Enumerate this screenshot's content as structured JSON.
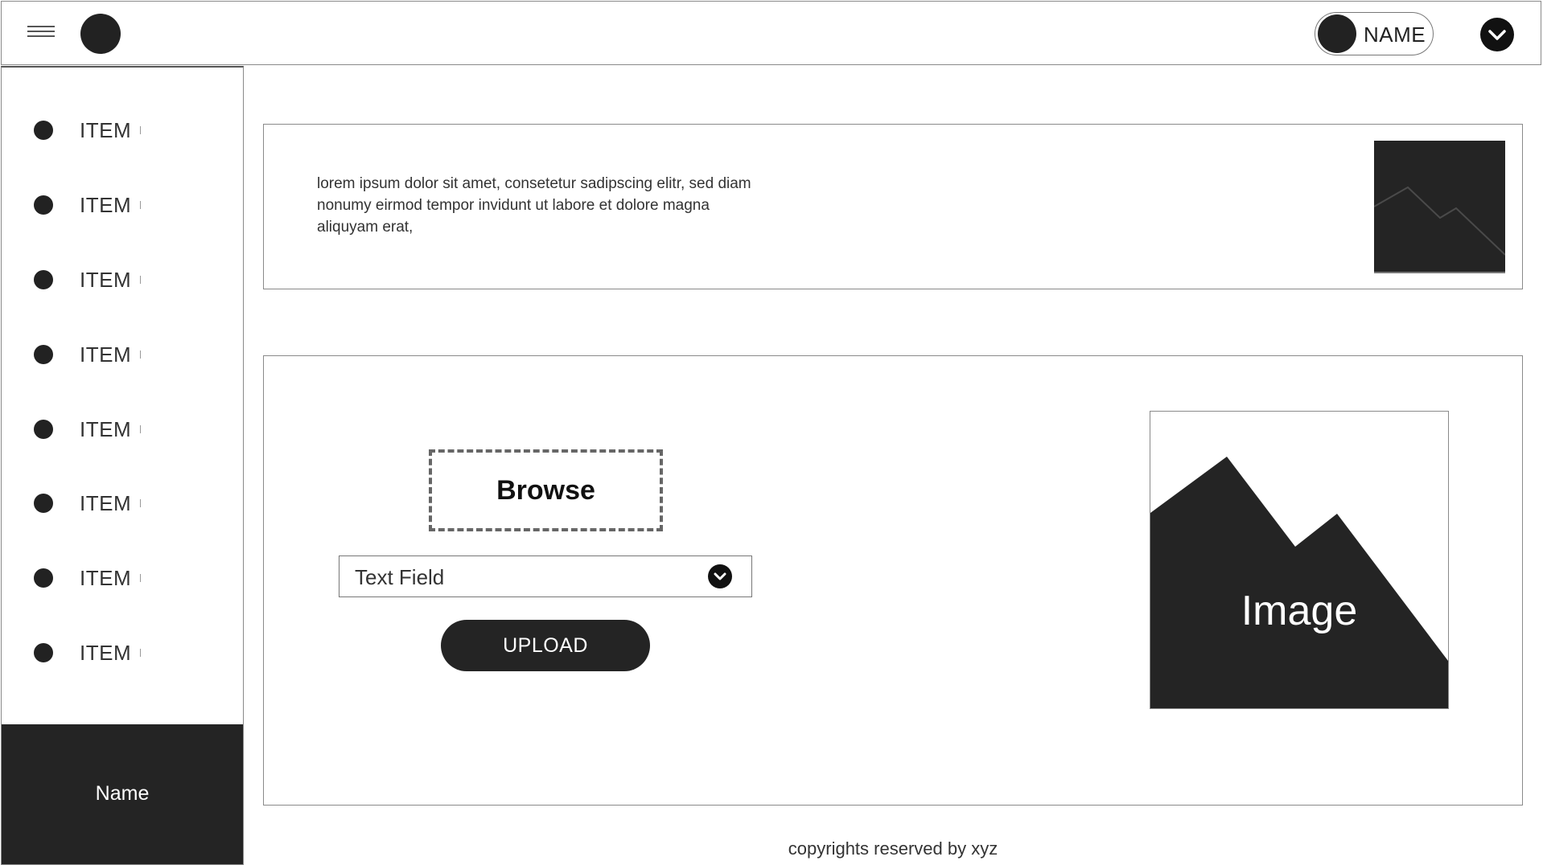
{
  "header": {
    "menu_icon": "hamburger-icon",
    "logo_icon": "circle-logo",
    "profile": {
      "name": "NAME"
    },
    "dropdown_icon": "chevron-down-icon"
  },
  "sidebar": {
    "items": [
      {
        "label": "ITEM"
      },
      {
        "label": "ITEM"
      },
      {
        "label": "ITEM"
      },
      {
        "label": "ITEM"
      },
      {
        "label": "ITEM"
      },
      {
        "label": "ITEM"
      },
      {
        "label": "ITEM"
      },
      {
        "label": "ITEM"
      }
    ],
    "footer": {
      "name": "Name"
    }
  },
  "info_card": {
    "text": "lorem ipsum dolor sit amet, consetetur sadipscing elitr, sed diam nonumy eirmod tempor invidunt ut labore et dolore magna aliquyam erat,",
    "thumbnail_icon": "image-placeholder-icon"
  },
  "upload": {
    "browse_label": "Browse",
    "select": {
      "value": "Text Field",
      "icon": "chevron-down-icon"
    },
    "upload_label": "UPLOAD",
    "image_caption": "Image"
  },
  "footer": {
    "copyright": "copyrights reserved by xyz"
  },
  "colors": {
    "dark": "#242424",
    "border": "#8a8a8a",
    "background": "#ffffff"
  }
}
